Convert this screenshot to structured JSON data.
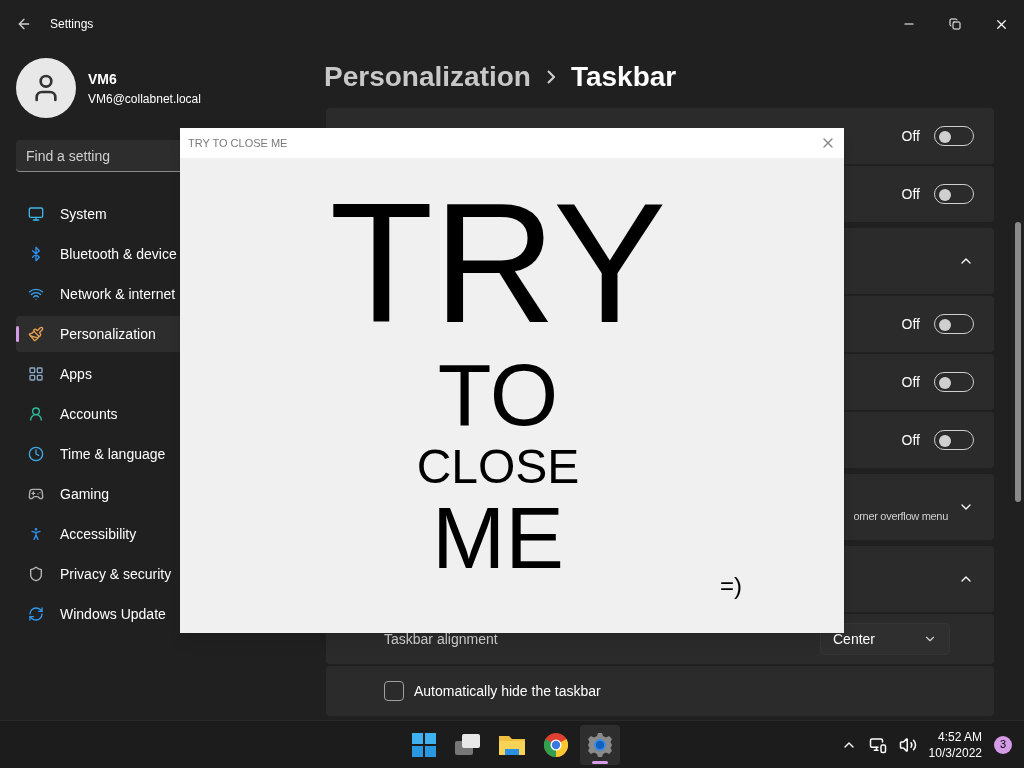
{
  "window": {
    "title": "Settings"
  },
  "user": {
    "name": "VM6",
    "email": "VM6@collabnet.local"
  },
  "search": {
    "placeholder": "Find a setting"
  },
  "nav": [
    {
      "label": "System",
      "selected": false
    },
    {
      "label": "Bluetooth & device",
      "selected": false
    },
    {
      "label": "Network & internet",
      "selected": false
    },
    {
      "label": "Personalization",
      "selected": true
    },
    {
      "label": "Apps",
      "selected": false
    },
    {
      "label": "Accounts",
      "selected": false
    },
    {
      "label": "Time & language",
      "selected": false
    },
    {
      "label": "Gaming",
      "selected": false
    },
    {
      "label": "Accessibility",
      "selected": false
    },
    {
      "label": "Privacy & security",
      "selected": false
    },
    {
      "label": "Windows Update",
      "selected": false
    }
  ],
  "breadcrumb": [
    "Personalization",
    "Taskbar"
  ],
  "settings_rows": [
    {
      "kind": "toggle",
      "on": false,
      "state_label": "Off"
    },
    {
      "kind": "toggle",
      "on": false,
      "state_label": "Off"
    },
    {
      "kind": "expander",
      "expanded": true
    },
    {
      "kind": "toggle",
      "on": false,
      "state_label": "Off"
    },
    {
      "kind": "toggle",
      "on": false,
      "state_label": "Off"
    },
    {
      "kind": "toggle",
      "on": false,
      "state_label": "Off"
    },
    {
      "kind": "expander",
      "expanded": false,
      "subtitle": "orner overflow menu"
    },
    {
      "kind": "expander",
      "expanded": true
    },
    {
      "kind": "dropdown",
      "label": "Taskbar alignment",
      "value": "Center"
    },
    {
      "kind": "checkbox",
      "label": "Automatically hide the taskbar",
      "checked": false
    }
  ],
  "dialog": {
    "title": "TRY TO CLOSE ME",
    "lines": [
      "TRY",
      "TO",
      "CLOSE",
      "ME"
    ],
    "smiley": "=)"
  },
  "taskbar": {
    "apps": [
      {
        "active": false
      },
      {
        "active": false
      },
      {
        "active": false
      },
      {
        "active": false
      },
      {
        "active": true
      }
    ],
    "clock": {
      "time": "4:52 AM",
      "date": "10/3/2022"
    },
    "notification_count": "3"
  }
}
